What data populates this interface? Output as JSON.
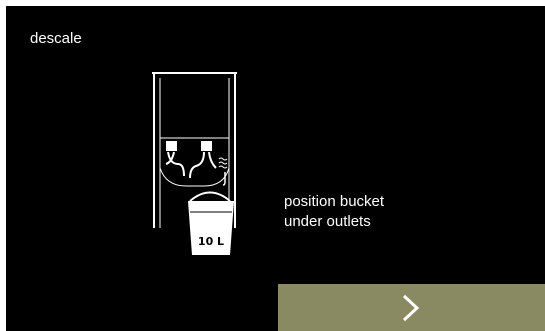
{
  "header": {
    "title": "descale"
  },
  "illustration": {
    "bucket_label": "10 L",
    "icon": "machine-bucket-illustration"
  },
  "instruction": {
    "line1": "position bucket",
    "line2": "under outlets"
  },
  "footer": {
    "next_icon": "chevron-right-icon"
  },
  "colors": {
    "background": "#000000",
    "text": "#ffffff",
    "button": "#8a8a62"
  }
}
